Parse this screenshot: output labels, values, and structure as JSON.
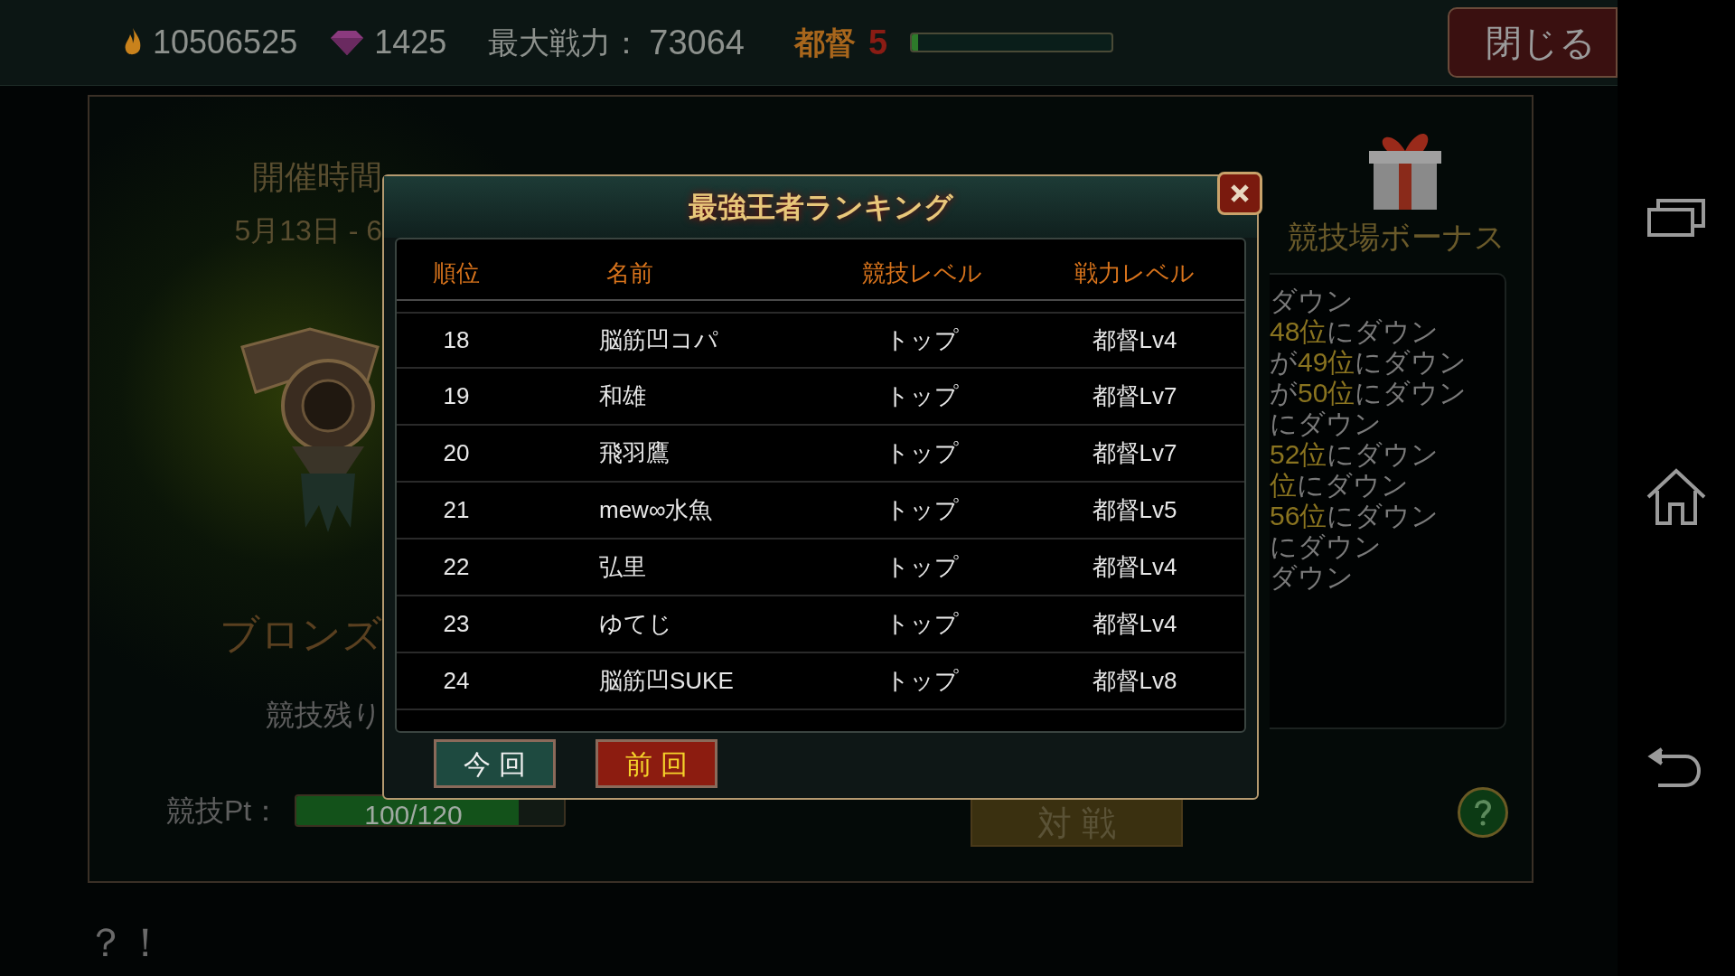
{
  "top_bar": {
    "gold": "10506525",
    "gems": "1425",
    "power_label": "最大戦力：",
    "power": "73064",
    "rank_title": "都督",
    "rank_level": "5",
    "exp": {
      "level": 0.03
    },
    "close_button": "閉じる"
  },
  "event_panel": {
    "period_label": "開催時間",
    "period": "5月13日 - 6",
    "league": "ブロンズ",
    "remaining_label": "競技残り",
    "points_label": "競技Pt：",
    "points": {
      "level": 0.83,
      "reading": "100/120"
    },
    "battle_button": "対 戦"
  },
  "bonus_panel": {
    "title": "競技場ボーナス",
    "lines": [
      [
        {
          "text": "ダウン",
          "highlight": false
        }
      ],
      [
        {
          "text": "48位",
          "highlight": true
        },
        {
          "text": "にダウン",
          "highlight": false
        }
      ],
      [
        {
          "text": "が",
          "highlight": false
        },
        {
          "text": "49位",
          "highlight": true
        },
        {
          "text": "にダウン",
          "highlight": false
        }
      ],
      [
        {
          "text": "が",
          "highlight": false
        },
        {
          "text": "50位",
          "highlight": true
        },
        {
          "text": "にダウン",
          "highlight": false
        }
      ],
      [
        {
          "text": "にダウン",
          "highlight": false
        }
      ],
      [
        {
          "text": "52位",
          "highlight": true
        },
        {
          "text": "にダウン",
          "highlight": false
        }
      ],
      [
        {
          "text": "位",
          "highlight": true
        },
        {
          "text": "にダウン",
          "highlight": false
        }
      ],
      [
        {
          "text": "56位",
          "highlight": true
        },
        {
          "text": "にダウン",
          "highlight": false
        }
      ],
      [
        {
          "text": "にダウン",
          "highlight": false
        }
      ],
      [
        {
          "text": "ダウン",
          "highlight": false
        }
      ]
    ]
  },
  "ranking_dialog": {
    "title": "最強王者ランキング",
    "columns": [
      "順位",
      "名前",
      "競技レベル",
      "戦力レベル"
    ],
    "rows": [
      {
        "rank": "18",
        "name": "脳筋凹コパ",
        "arena_level": "トップ",
        "power_level": "都督Lv4"
      },
      {
        "rank": "19",
        "name": "和雄",
        "arena_level": "トップ",
        "power_level": "都督Lv7"
      },
      {
        "rank": "20",
        "name": "飛羽鷹",
        "arena_level": "トップ",
        "power_level": "都督Lv7"
      },
      {
        "rank": "21",
        "name": "mew∞水魚",
        "arena_level": "トップ",
        "power_level": "都督Lv5"
      },
      {
        "rank": "22",
        "name": "弘里",
        "arena_level": "トップ",
        "power_level": "都督Lv4"
      },
      {
        "rank": "23",
        "name": "ゆてじ",
        "arena_level": "トップ",
        "power_level": "都督Lv4"
      },
      {
        "rank": "24",
        "name": "脳筋凹SUKE",
        "arena_level": "トップ",
        "power_level": "都督Lv8"
      }
    ],
    "tabs": [
      {
        "label": "今 回",
        "selected": false
      },
      {
        "label": "前 回",
        "selected": true
      }
    ]
  },
  "footer_text": "？！"
}
